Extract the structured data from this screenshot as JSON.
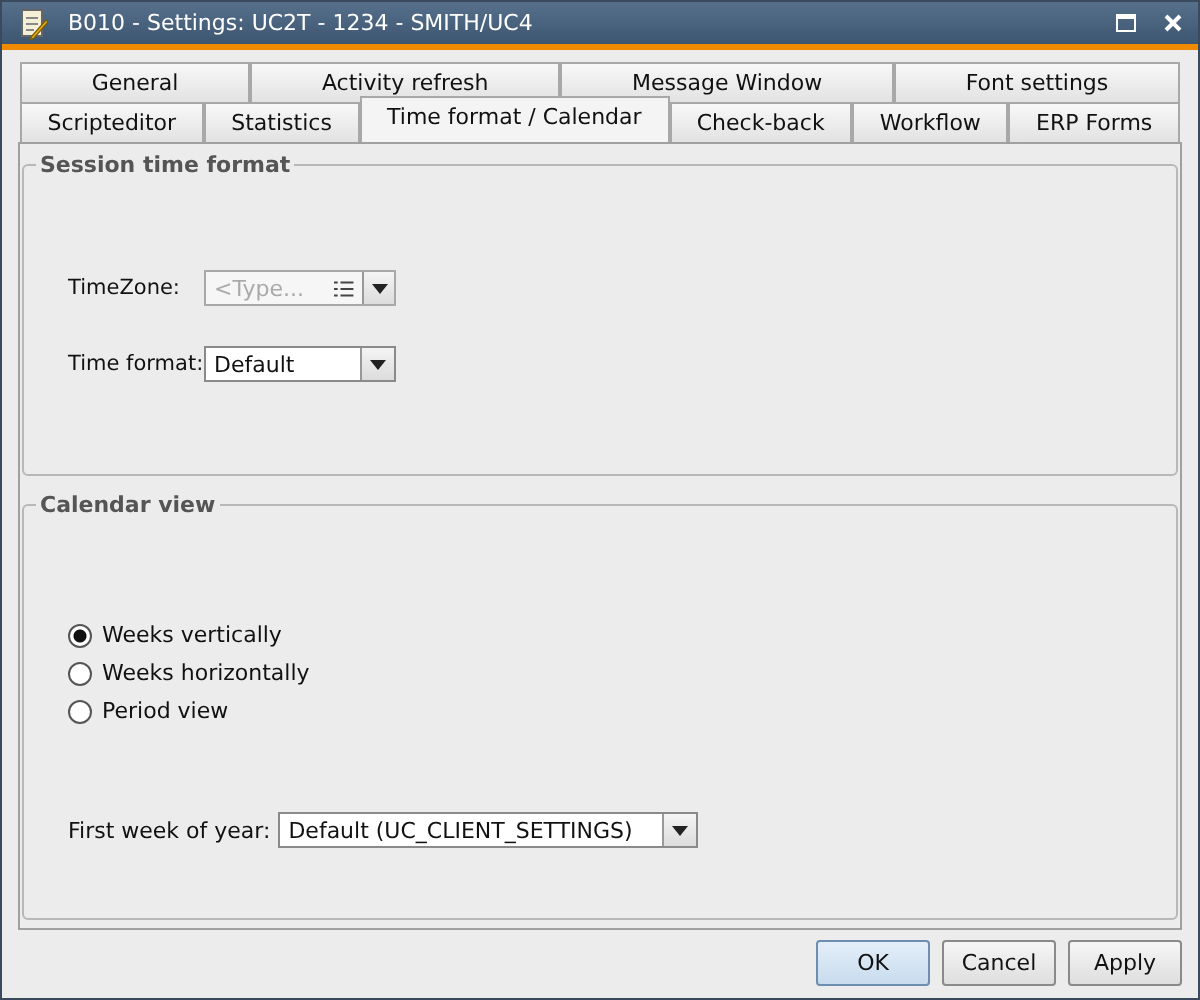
{
  "window": {
    "title": "B010 - Settings: UC2T - 1234 - SMITH/UC4"
  },
  "tab_rows": [
    [
      {
        "label": "General",
        "selected": false
      },
      {
        "label": "Activity refresh",
        "selected": false
      },
      {
        "label": "Message Window",
        "selected": false
      },
      {
        "label": "Font settings",
        "selected": false
      }
    ],
    [
      {
        "label": "Scripteditor",
        "selected": false
      },
      {
        "label": "Statistics",
        "selected": false
      },
      {
        "label": "Time format / Calendar",
        "selected": true
      },
      {
        "label": "Check-back",
        "selected": false
      },
      {
        "label": "Workflow",
        "selected": false
      },
      {
        "label": "ERP Forms",
        "selected": false
      }
    ]
  ],
  "session_time_format": {
    "title": "Session time format",
    "timezone": {
      "label": "TimeZone:",
      "placeholder": "<Type...",
      "disabled": true
    },
    "time_format": {
      "label": "Time format:",
      "value": "Default",
      "disabled": false
    }
  },
  "calendar_view": {
    "title": "Calendar view",
    "options": [
      {
        "label": "Weeks vertically",
        "selected": true
      },
      {
        "label": "Weeks horizontally",
        "selected": false
      },
      {
        "label": "Period view",
        "selected": false
      }
    ],
    "first_week": {
      "label": "First week of year:",
      "value": "Default (UC_CLIENT_SETTINGS)",
      "disabled": false
    }
  },
  "buttons": [
    {
      "label": "OK",
      "default": true
    },
    {
      "label": "Cancel",
      "default": false
    },
    {
      "label": "Apply",
      "default": false
    }
  ]
}
